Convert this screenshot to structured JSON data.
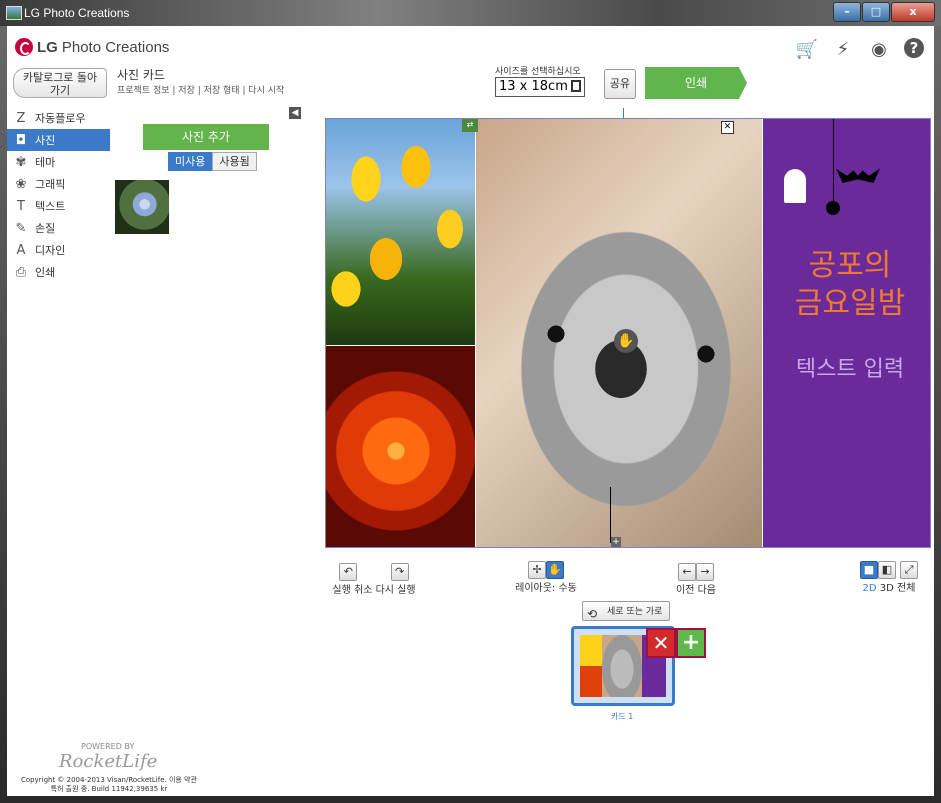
{
  "window": {
    "title": "LG Photo Creations",
    "min": "–",
    "max": "□",
    "close": "x"
  },
  "brand": {
    "bold": "LG",
    "rest": "Photo Creations"
  },
  "header": {
    "back_line1": "카탈로그로 돌아",
    "back_line2": "가기",
    "project_title": "사진 카드",
    "links": "프로젝트 정보 | 저장 | 저장 형태 | 다시 시작",
    "size_label": "사이즈를 선택하십시오",
    "size_value": "13 x 18cm",
    "share": "공유",
    "print": "인쇄"
  },
  "top_icons": [
    "cart-icon",
    "flash-icon",
    "globe-icon",
    "help-icon"
  ],
  "sidebar": {
    "items": [
      {
        "icon": "Z",
        "label": "자동플로우"
      },
      {
        "icon": "◘",
        "label": "사진"
      },
      {
        "icon": "✾",
        "label": "테마"
      },
      {
        "icon": "❀",
        "label": "그래픽"
      },
      {
        "icon": "T",
        "label": "텍스트"
      },
      {
        "icon": "✎",
        "label": "손질"
      },
      {
        "icon": "A",
        "label": "디자인"
      },
      {
        "icon": "⎙",
        "label": "인쇄"
      }
    ]
  },
  "photos_panel": {
    "add_photo": "사진 추가",
    "unused": "미사용",
    "used": "사용됨"
  },
  "canvas": {
    "title_text": "공포의\n금요일밤",
    "text_placeholder": "텍스트 입력"
  },
  "toolbar": {
    "undo_redo": "실행 취소 다시 실행",
    "layout": "레이아웃: 수동",
    "prev_next": "이전 다음",
    "view_2d": "2D",
    "view_3d": "3D",
    "fullscreen": "전체",
    "orientation": "세로 또는 가로"
  },
  "pages": {
    "thumb_label": "카드 1"
  },
  "footer": {
    "powered": "POWERED BY",
    "rocketlife": "RocketLife",
    "copyright": "Copyright © 2004-2013 Visan/RocketLife. 이용 약관",
    "build": "특허 출원 중. Build 11942,39635 kr"
  },
  "colors": {
    "accent": "#3a7ac8",
    "green": "#61b54d",
    "purple": "#6a2a9c",
    "orange": "#f07a2c"
  }
}
